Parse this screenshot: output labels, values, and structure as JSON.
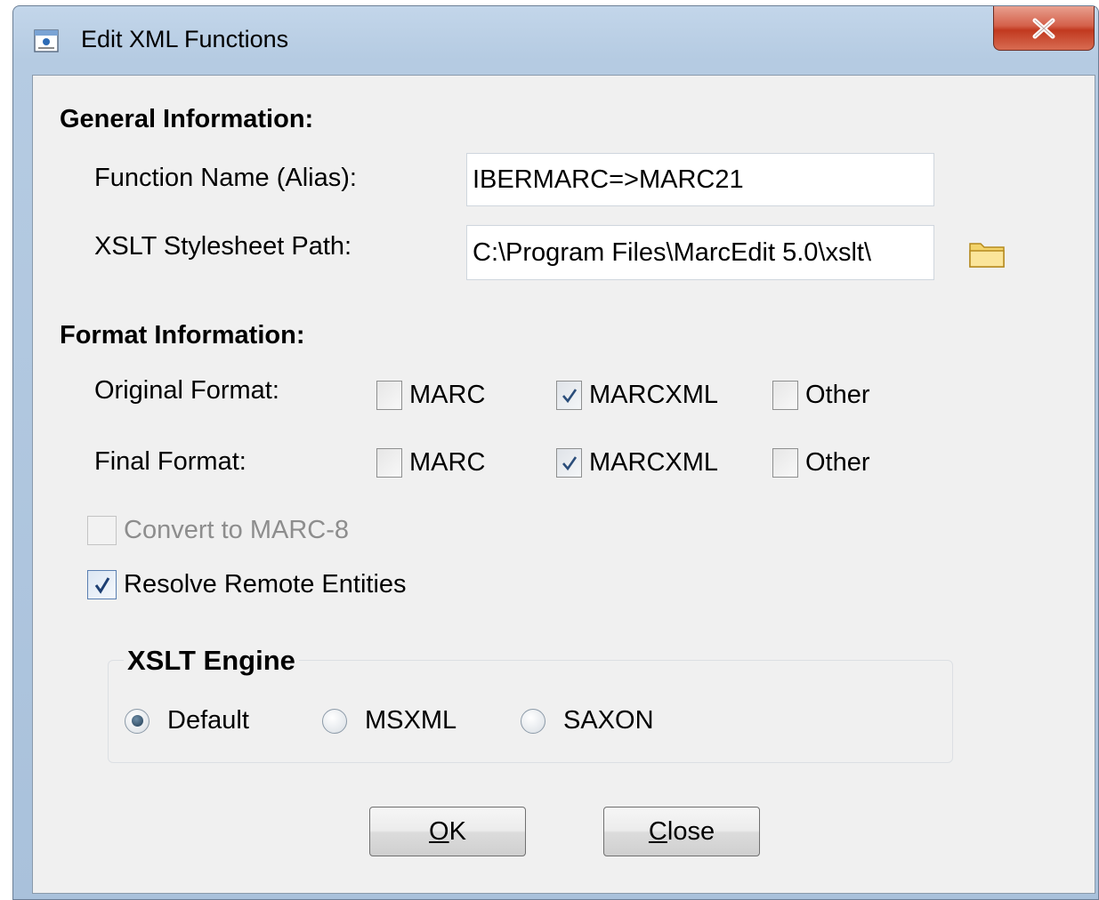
{
  "window": {
    "title": "Edit XML Functions",
    "close_glyph": "X"
  },
  "general": {
    "heading": "General Information:",
    "function_name_label": "Function Name (Alias):",
    "function_name_value": "IBERMARC=>MARC21",
    "xslt_path_label": "XSLT Stylesheet Path:",
    "xslt_path_value": "C:\\Program Files\\MarcEdit 5.0\\xslt\\"
  },
  "format": {
    "heading": "Format Information:",
    "original_label": "Original Format:",
    "final_label": "Final Format:",
    "original_options": [
      {
        "label": "MARC",
        "checked": false
      },
      {
        "label": "MARCXML",
        "checked": true
      },
      {
        "label": "Other",
        "checked": false
      }
    ],
    "final_options": [
      {
        "label": "MARC",
        "checked": false
      },
      {
        "label": "MARCXML",
        "checked": true
      },
      {
        "label": "Other",
        "checked": false
      }
    ]
  },
  "options": {
    "convert_marc8": {
      "label": "Convert to MARC-8",
      "checked": false,
      "enabled": false
    },
    "resolve_entities": {
      "label": "Resolve Remote Entities",
      "checked": true,
      "enabled": true
    }
  },
  "engine": {
    "title": "XSLT Engine",
    "options": [
      "Default",
      "MSXML",
      "SAXON"
    ],
    "selected": "Default"
  },
  "buttons": {
    "ok_mnemonic": "O",
    "ok_rest": "K",
    "close_mnemonic": "C",
    "close_rest": "lose"
  },
  "icons": {
    "app": "dialog-icon",
    "browse": "folder-icon",
    "close": "close-icon"
  }
}
